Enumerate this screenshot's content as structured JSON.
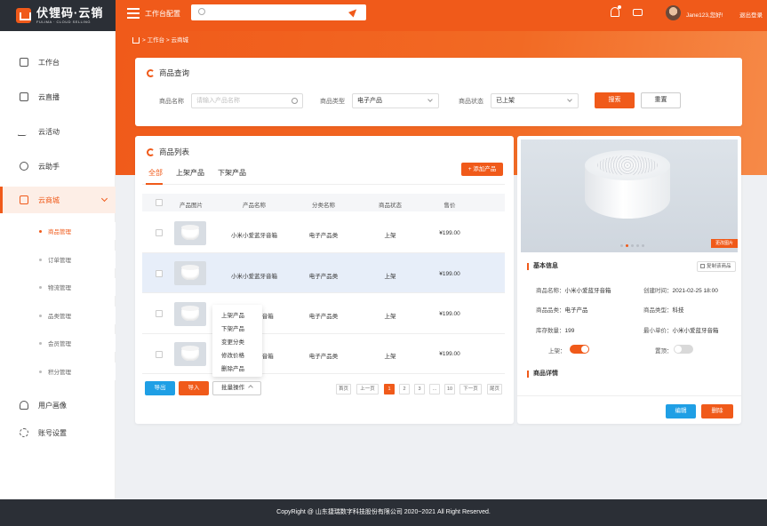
{
  "brand": {
    "name": "伏锂码·云销",
    "tagline": "FULIMA · CLOUD SELLING"
  },
  "topbar": {
    "title": "工作台配置",
    "user": "Jane123,您好!",
    "logout": "退出登录"
  },
  "breadcrumb": "> 工作台 > 云商城",
  "sidebar": {
    "items": [
      {
        "label": "工作台",
        "icon": "clipboard-icon"
      },
      {
        "label": "云直播",
        "icon": "camera-icon"
      },
      {
        "label": "云活动",
        "icon": "activity-icon"
      },
      {
        "label": "云助手",
        "icon": "clock-icon"
      },
      {
        "label": "云商城",
        "icon": "shop-icon"
      },
      {
        "label": "用户画像",
        "icon": "user-icon"
      },
      {
        "label": "账号设置",
        "icon": "gear-icon"
      }
    ],
    "sub_items": [
      "商品管理",
      "订单管理",
      "物流管理",
      "品类管理",
      "会员管理",
      "积分管理"
    ]
  },
  "query": {
    "title": "商品查询",
    "name_label": "商品名称",
    "name_placeholder": "请输入产品名称",
    "type_label": "商品类型",
    "type_value": "电子产品",
    "status_label": "商品状态",
    "status_value": "已上架",
    "search_btn": "搜索",
    "reset_btn": "重置"
  },
  "list": {
    "title": "商品列表",
    "tabs": [
      "全部",
      "上架产品",
      "下架产品"
    ],
    "add_btn": "添加产品",
    "columns": [
      "产品图片",
      "产品名称",
      "分类名称",
      "商品状态",
      "售价"
    ],
    "rows": [
      {
        "name": "小米小爱蓝牙音箱",
        "category": "电子产品类",
        "status": "上架",
        "price": "¥199.00"
      },
      {
        "name": "小米小爱蓝牙音箱",
        "category": "电子产品类",
        "status": "上架",
        "price": "¥199.00"
      },
      {
        "name": "牙音箱",
        "category": "电子产品类",
        "status": "上架",
        "price": "¥199.00"
      },
      {
        "name": "牙音箱",
        "category": "电子产品类",
        "status": "上架",
        "price": "¥199.00"
      }
    ],
    "export_btn": "导出",
    "import_btn": "导入",
    "batch_btn": "批量操作",
    "batch_menu": [
      "上架产品",
      "下架产品",
      "变更分类",
      "修改价格",
      "删除产品"
    ],
    "pagination": {
      "first": "首页",
      "prev": "上一页",
      "pages": [
        "1",
        "2",
        "3",
        "...",
        "10"
      ],
      "next": "下一页",
      "last": "尾页",
      "current": "1"
    }
  },
  "detail": {
    "change_img": "更改图片",
    "basic_title": "基本信息",
    "copy_btn": "复制该商品",
    "fields": {
      "name_label": "商品名称：",
      "name": "小米小爱蓝牙音箱",
      "created_label": "创建时间：",
      "created": "2021-02-25 18:00",
      "brand_label": "商品品类：",
      "brand": "电子产品",
      "type_label": "商品类型：",
      "type": "科技",
      "stock_label": "库存数量：",
      "stock": "199",
      "min_unit_label": "最小单价：",
      "min_unit": "小米小爱蓝牙音箱",
      "shelf_label": "上架：",
      "top_label": "置顶："
    },
    "toggles": {
      "shelf": true,
      "top": false
    },
    "detail_title": "商品详情",
    "edit_btn": "编辑",
    "delete_btn": "删除"
  },
  "footer": "CopyRight @ 山东捷瑞数字科技股份有限公司 2020~2021 All Right Reserved.",
  "colors": {
    "accent": "#f05a1a",
    "dark": "#2b2f36",
    "blue": "#1f9fe5"
  }
}
